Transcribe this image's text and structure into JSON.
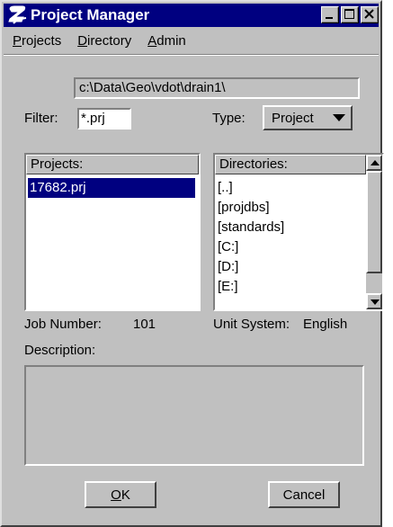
{
  "window": {
    "title": "Project Manager",
    "title_icon": "app-logo-icon",
    "buttons": [
      "minimize-icon",
      "maximize-icon",
      "close-icon"
    ]
  },
  "menu": {
    "items": [
      {
        "label": "Projects",
        "accel": "P",
        "rest": "rojects"
      },
      {
        "label": "Directory",
        "accel": "D",
        "rest": "irectory"
      },
      {
        "label": "Admin",
        "accel": "A",
        "rest": "dmin"
      }
    ]
  },
  "path": "c:\\Data\\Geo\\vdot\\drain1\\",
  "filter": {
    "label": "Filter:",
    "value": "*.prj"
  },
  "type": {
    "label": "Type:",
    "value": "Project"
  },
  "projects": {
    "header": "Projects:",
    "items": [
      "17682.prj"
    ],
    "selected": "17682.prj"
  },
  "directories": {
    "header": "Directories:",
    "items": [
      "[..]",
      "[projdbs]",
      "[standards]",
      "[C:]",
      "[D:]",
      "[E:]"
    ]
  },
  "job_number": {
    "label": "Job Number:",
    "value": "101"
  },
  "unit_system": {
    "label": "Unit System:",
    "value": "English"
  },
  "description": {
    "label": "Description:",
    "value": ""
  },
  "buttons": {
    "ok": {
      "label": "OK",
      "accel": "O",
      "rest": "K"
    },
    "cancel": {
      "label": "Cancel"
    }
  },
  "colors": {
    "face": "#c0c0c0",
    "title": "#000080",
    "selection": "#000080"
  }
}
